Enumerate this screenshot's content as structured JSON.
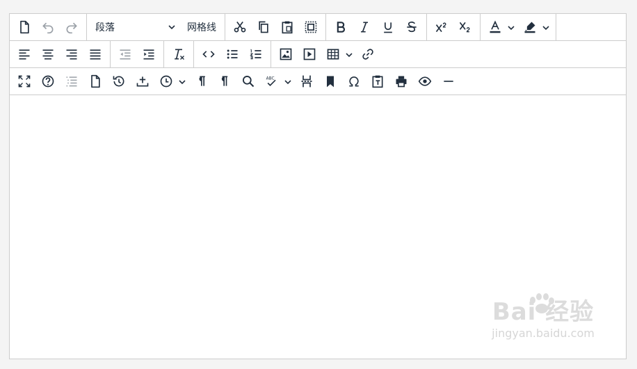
{
  "toolbar": {
    "row1": {
      "new_document_icon": "file-icon",
      "undo_icon": "undo-icon",
      "redo_icon": "redo-icon",
      "block_format_value": "段落",
      "gridlines_label": "网格线",
      "cut_icon": "scissors-icon",
      "copy_icon": "copy-icon",
      "paste_icon": "paste-icon",
      "select_all_icon": "select-all-icon",
      "bold_icon": "bold-icon",
      "italic_icon": "italic-icon",
      "underline_icon": "underline-icon",
      "strikethrough_icon": "strikethrough-icon",
      "superscript_icon": "superscript-icon",
      "subscript_icon": "subscript-icon",
      "text_color_icon": "text-color-icon",
      "highlight_color_icon": "highlight-icon"
    },
    "row2": {
      "align_left_icon": "align-left-icon",
      "align_center_icon": "align-center-icon",
      "align_right_icon": "align-right-icon",
      "align_justify_icon": "align-justify-icon",
      "outdent_icon": "outdent-icon",
      "indent_icon": "indent-icon",
      "remove_format_icon": "remove-format-icon",
      "code_icon": "code-icon",
      "bullet_list_icon": "bullet-list-icon",
      "numbered_list_icon": "numbered-list-icon",
      "image_icon": "image-icon",
      "media_icon": "media-icon",
      "table_icon": "table-icon",
      "link_icon": "link-icon"
    },
    "row3": {
      "fullscreen_icon": "fullscreen-icon",
      "help_icon": "help-icon",
      "toc_icon": "toc-icon",
      "template_icon": "template-icon",
      "restore_draft_icon": "restore-draft-icon",
      "upload_icon": "upload-icon",
      "insert_datetime_icon": "clock-icon",
      "ltr_icon": "ltr-icon",
      "rtl_icon": "rtl-icon",
      "search_replace_icon": "search-icon",
      "spellcheck_icon": "spellcheck-icon",
      "page_break_icon": "page-break-icon",
      "bookmark_icon": "bookmark-icon",
      "special_char_icon": "omega-icon",
      "paste_text_icon": "paste-text-icon",
      "print_icon": "print-icon",
      "preview_icon": "preview-icon",
      "horizontal_rule_icon": "horizontal-rule-icon",
      "spellcheck_caption": "ABC"
    }
  },
  "watermark": {
    "brand": "Bai  经验",
    "url": "jingyan.baidu.com"
  },
  "colors": {
    "icon": "#222f3e",
    "border": "#cccccc",
    "background": "#f4f4f4",
    "editor_bg": "#ffffff",
    "watermark": "#d8d8d8"
  }
}
